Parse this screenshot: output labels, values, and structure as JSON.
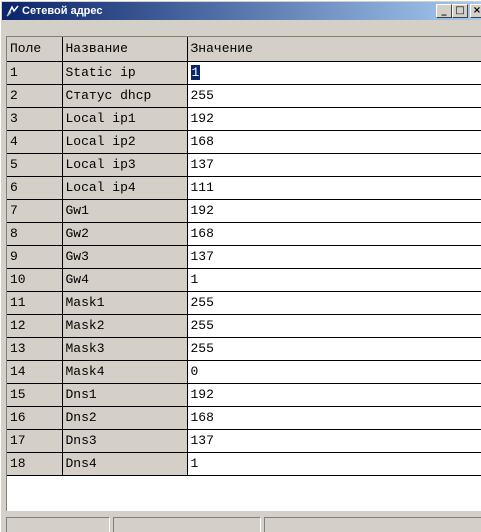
{
  "window": {
    "title": "Сетевой адрес",
    "buttons": {
      "minimize_icon": "minimize-icon",
      "maximize_icon": "maximize-icon",
      "close_icon": "close-icon"
    },
    "colors": {
      "title_start": "#0a246a",
      "title_end": "#a6caf0",
      "face": "#d4d0c8",
      "selection": "#0a246a"
    }
  },
  "grid": {
    "headers": [
      "Поле",
      "Название",
      "Значение"
    ],
    "rows": [
      {
        "field": "1",
        "name": "Static ip",
        "value": "1"
      },
      {
        "field": "2",
        "name": "Статус dhcp",
        "value": "255"
      },
      {
        "field": "3",
        "name": "Local ip1",
        "value": "192"
      },
      {
        "field": "4",
        "name": "Local ip2",
        "value": "168"
      },
      {
        "field": "5",
        "name": "Local ip3",
        "value": "137"
      },
      {
        "field": "6",
        "name": "Local ip4",
        "value": "111"
      },
      {
        "field": "7",
        "name": "Gw1",
        "value": "192"
      },
      {
        "field": "8",
        "name": "Gw2",
        "value": "168"
      },
      {
        "field": "9",
        "name": "Gw3",
        "value": "137"
      },
      {
        "field": "10",
        "name": "Gw4",
        "value": "1"
      },
      {
        "field": "11",
        "name": "Mask1",
        "value": "255"
      },
      {
        "field": "12",
        "name": "Mask2",
        "value": "255"
      },
      {
        "field": "13",
        "name": "Mask3",
        "value": "255"
      },
      {
        "field": "14",
        "name": "Mask4",
        "value": "0"
      },
      {
        "field": "15",
        "name": "Dns1",
        "value": "192"
      },
      {
        "field": "16",
        "name": "Dns2",
        "value": "168"
      },
      {
        "field": "17",
        "name": "Dns3",
        "value": "137"
      },
      {
        "field": "18",
        "name": "Dns4",
        "value": "1"
      }
    ],
    "selected_row": 0
  },
  "statusbar": {
    "panels": [
      "",
      "",
      ""
    ]
  }
}
